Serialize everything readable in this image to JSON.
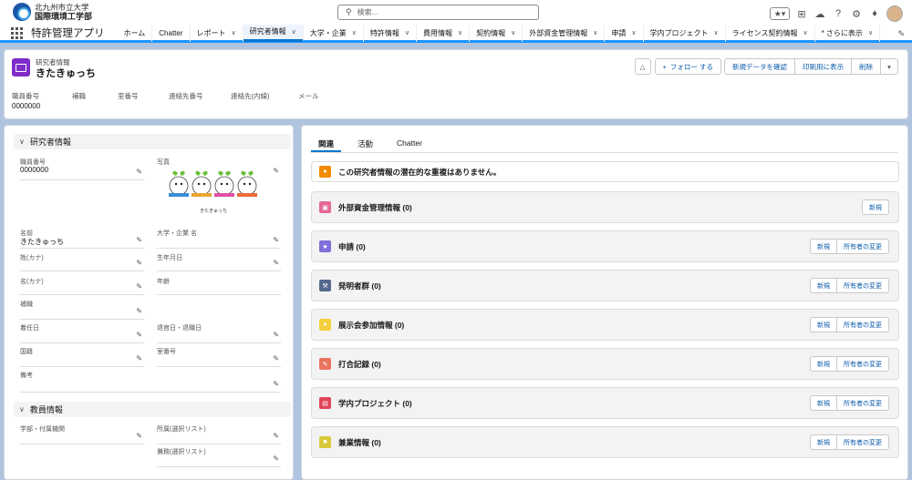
{
  "org": {
    "line1": "北九州市立大学",
    "line2": "国際環境工学部"
  },
  "search": {
    "placeholder": "検索..."
  },
  "app_name": "特許管理アプリ",
  "nav": [
    {
      "label": "ホーム",
      "chev": false
    },
    {
      "label": "Chatter",
      "chev": false
    },
    {
      "label": "レポート",
      "chev": true
    },
    {
      "label": "研究者情報",
      "chev": true,
      "active": true
    },
    {
      "label": "大学・企業",
      "chev": true
    },
    {
      "label": "特許情報",
      "chev": true
    },
    {
      "label": "費用情報",
      "chev": true
    },
    {
      "label": "契約情報",
      "chev": true
    },
    {
      "label": "外部資金管理情報",
      "chev": true
    },
    {
      "label": "申請",
      "chev": true
    },
    {
      "label": "学内プロジェクト",
      "chev": true
    },
    {
      "label": "ライセンス契約情報",
      "chev": true
    },
    {
      "label": "* さらに表示",
      "chev": true
    }
  ],
  "header": {
    "object_label": "研究者情報",
    "record_name": "きたきゅっち",
    "actions": {
      "follow": "フォロー する",
      "check_new": "新規データを確認",
      "print": "印刷用に表示",
      "delete": "削除"
    },
    "fields": [
      "職員番号",
      "補職",
      "室番号",
      "連絡先番号",
      "連絡先(内線)",
      "メール"
    ],
    "staff_no_value": "0000000"
  },
  "left": {
    "sec1": "研究者情報",
    "sec2": "教員情報",
    "photo_caption": "きたきゅっち",
    "f": {
      "staff_no": "職員番号",
      "staff_no_val": "0000000",
      "photo": "写真",
      "name": "名前",
      "name_val": "きたきゅっち",
      "univ": "大学・企業 名",
      "last_kana": "姓(カナ)",
      "birth": "生年月日",
      "first_kana": "名(カナ)",
      "age": "年齢",
      "post": "補職",
      "start": "着任日",
      "leave": "退官日・退職日",
      "nation": "国籍",
      "room": "室番号",
      "memo": "備考",
      "dept": "学部・付属機関",
      "affil": "所属(選択リスト)",
      "concurrent": "兼務(選択リスト)"
    }
  },
  "right": {
    "tabs": [
      "関連",
      "活動",
      "Chatter"
    ],
    "dup_msg": "この研究者情報の潜在的な重複はありません。",
    "btn_new": "新規",
    "btn_owner": "所有者の変更",
    "cards": [
      {
        "title": "外部資金管理情報 (0)",
        "color": "#e56798",
        "icon": "box"
      },
      {
        "title": "申請 (0)",
        "color": "#7f6fd8",
        "icon": "star"
      },
      {
        "title": "発明者群 (0)",
        "color": "#54698d",
        "icon": "wrench"
      },
      {
        "title": "展示会参加情報 (0)",
        "color": "#f4d03f",
        "icon": "circle"
      },
      {
        "title": "打合記録 (0)",
        "color": "#e8745d",
        "icon": "pencil"
      },
      {
        "title": "学内プロジェクト (0)",
        "color": "#e0455a",
        "icon": "card"
      },
      {
        "title": "兼業情報 (0)",
        "color": "#d9c93a",
        "icon": "bag"
      }
    ]
  }
}
